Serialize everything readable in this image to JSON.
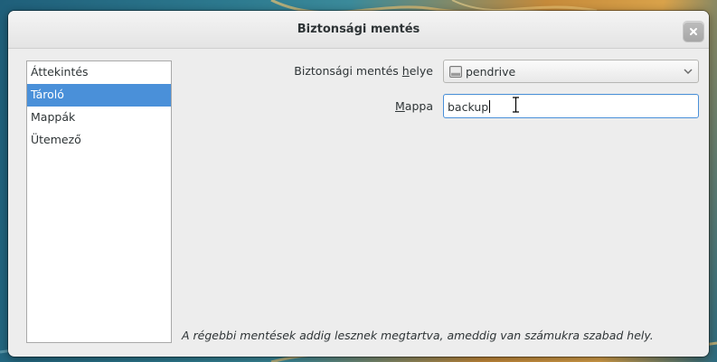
{
  "window": {
    "title": "Biztonsági mentés"
  },
  "sidebar": {
    "items": [
      {
        "label": "Áttekintés",
        "selected": false
      },
      {
        "label": "Tároló",
        "selected": true
      },
      {
        "label": "Mappák",
        "selected": false
      },
      {
        "label": "Ütemező",
        "selected": false
      }
    ]
  },
  "form": {
    "location_label_prefix": "Biztonsági mentés ",
    "location_label_mnemonic": "h",
    "location_label_suffix": "elye",
    "location_value": "pendrive",
    "location_icon": "drive-icon",
    "folder_label_mnemonic": "M",
    "folder_label_suffix": "appa",
    "folder_value": "backup"
  },
  "footer": {
    "note": "A régebbi mentések addig lesznek megtartva, ameddig van számukra szabad hely."
  },
  "colors": {
    "selection": "#4a90d9",
    "window_bg": "#ededed"
  }
}
